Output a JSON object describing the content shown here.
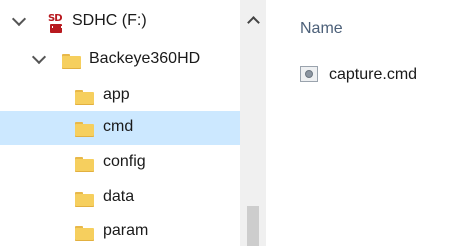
{
  "tree": {
    "drive": {
      "label": "SDHC (F:)",
      "icon": "sd-card-icon",
      "expanded": true
    },
    "folder": {
      "label": "Backeye360HD",
      "icon": "folder-icon",
      "expanded": true
    },
    "children": [
      {
        "label": "app",
        "selected": false
      },
      {
        "label": "cmd",
        "selected": true
      },
      {
        "label": "config",
        "selected": false
      },
      {
        "label": "data",
        "selected": false
      },
      {
        "label": "param",
        "selected": false
      }
    ]
  },
  "content": {
    "column_header": "Name",
    "files": [
      {
        "name": "capture.cmd",
        "icon": "system-file-icon"
      }
    ]
  },
  "colors": {
    "selection": "#cce8ff",
    "folder": "#f6cf5e",
    "header_text": "#4c6079",
    "sd_red": "#b8191f"
  }
}
